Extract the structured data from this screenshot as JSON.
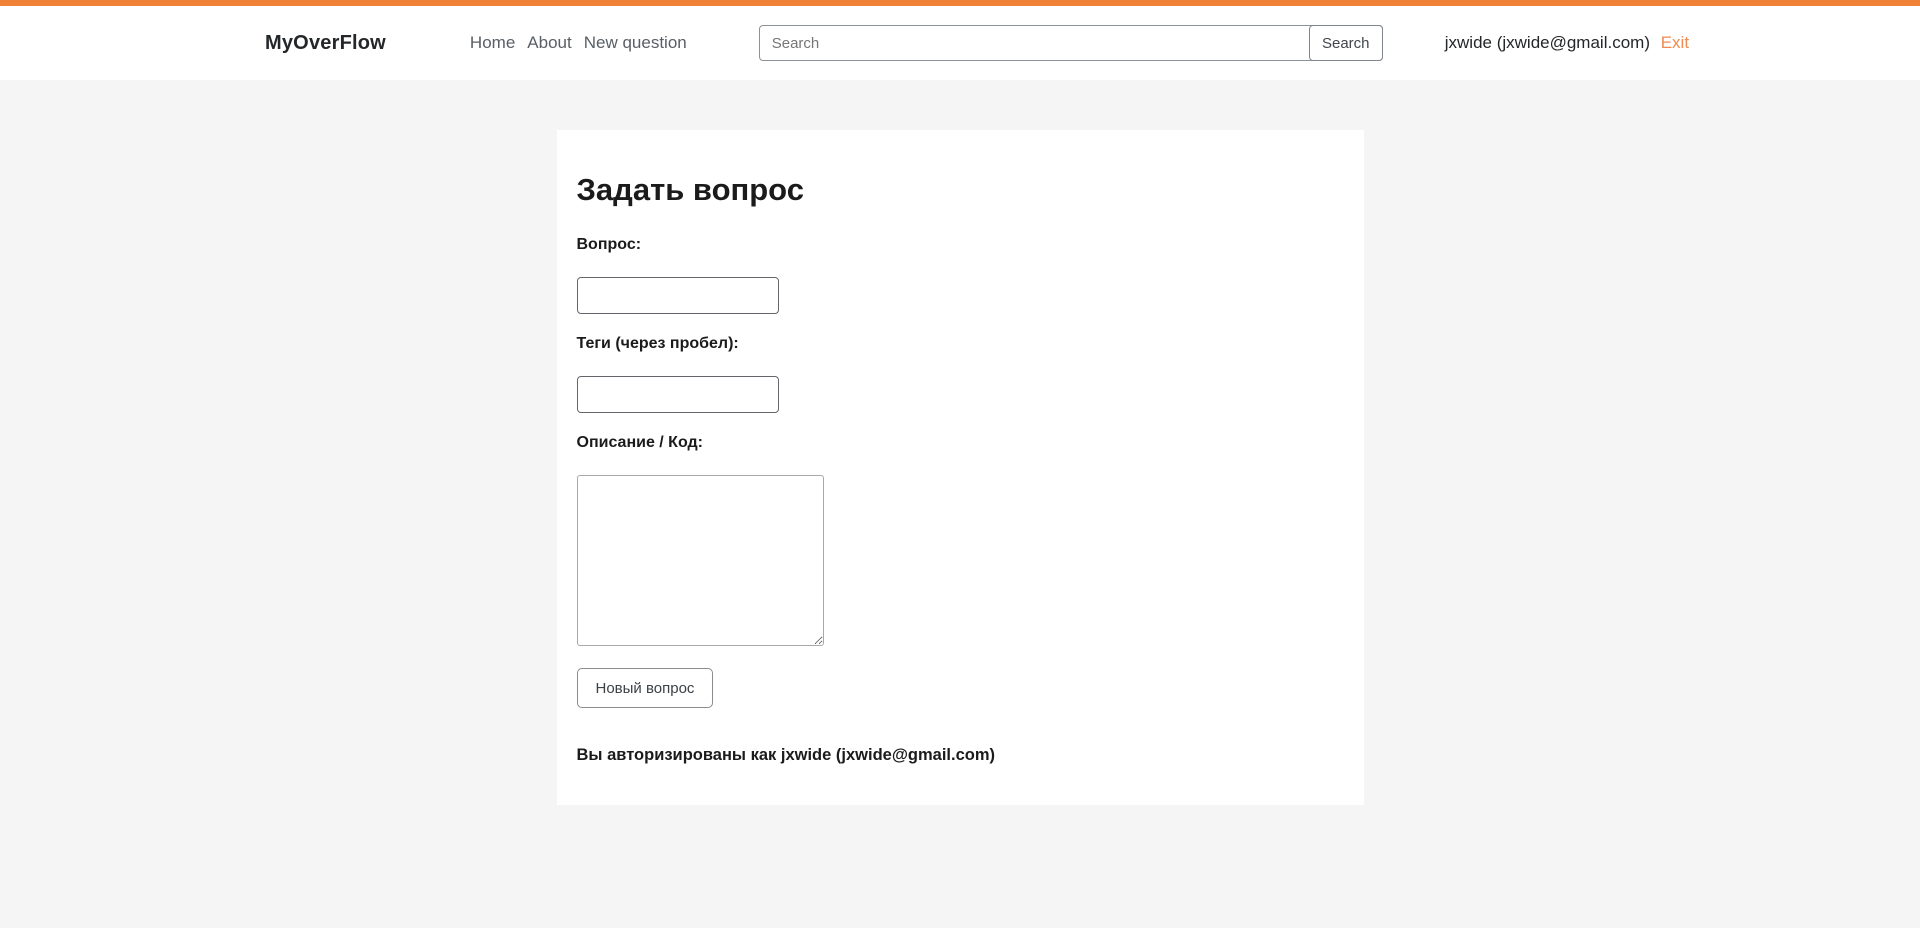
{
  "header": {
    "logo": "MyOverFlow",
    "nav": [
      {
        "label": "Home"
      },
      {
        "label": "About"
      },
      {
        "label": "New question"
      }
    ],
    "search": {
      "placeholder": "Search",
      "value": "",
      "button_label": "Search"
    },
    "user": {
      "display": "jxwide (jxwide@gmail.com)",
      "exit_label": "Exit"
    }
  },
  "form": {
    "title": "Задать вопрос",
    "question_label": "Вопрос:",
    "question_value": "",
    "tags_label": "Теги (через пробел):",
    "tags_value": "",
    "description_label": "Описание / Код:",
    "description_value": "",
    "submit_label": "Новый вопрос",
    "auth_note": "Вы авторизированы как jxwide (jxwide@gmail.com)"
  },
  "colors": {
    "accent_bar": "#ef8236",
    "exit_link": "#ef8b52",
    "page_background": "#f5f5f5",
    "card_background": "#ffffff"
  }
}
